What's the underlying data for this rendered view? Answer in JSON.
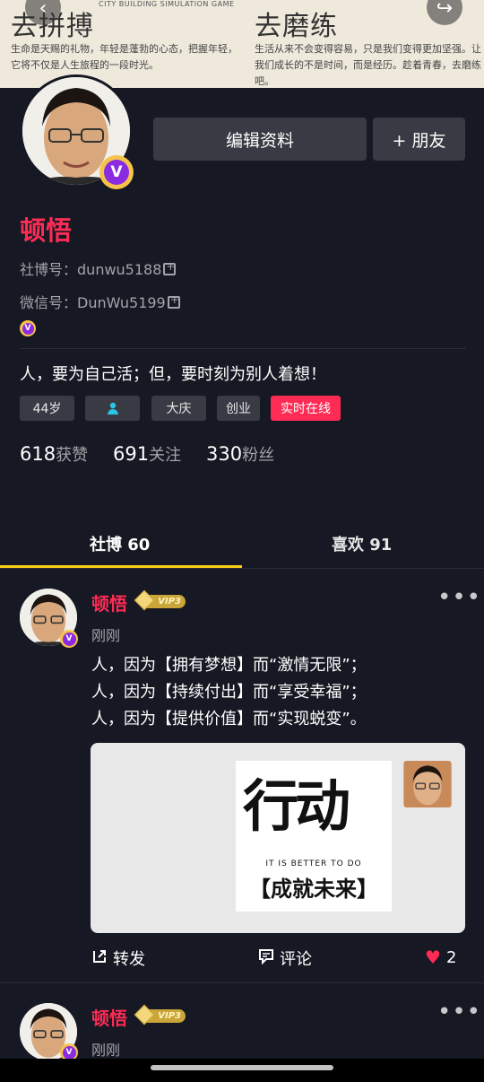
{
  "banner": {
    "left_title": "去拼搏",
    "left_tag": "CITY BUILDING SIMULATION GAME",
    "left_text": "生命是天赐的礼物，年轻是蓬勃的心态，把握年轻，它将不仅是人生旅程的一段时光。",
    "right_title": "去磨练",
    "right_text": "生活从来不会变得容易，只是我们变得更加坚强。让我们成长的不是时间，而是经历。趁着青春，去磨练吧。",
    "back_icon": "back-icon",
    "share_icon": "share-icon"
  },
  "profile": {
    "edit_button": "编辑资料",
    "add_friend_button": "+ 朋友",
    "name": "顿悟",
    "id_label": "社博号：",
    "id_value": "dunwu5188",
    "wechat_label": "微信号：",
    "wechat_value": "DunWu5199",
    "verified_badge": "V",
    "bio": "人，要为自己活；但，要时刻为别人着想！",
    "tags": [
      "44岁",
      "",
      "大庆",
      "创业",
      "实时在线"
    ],
    "stats": [
      {
        "value": "618",
        "label": "获赞"
      },
      {
        "value": "691",
        "label": "关注"
      },
      {
        "value": "330",
        "label": "粉丝"
      }
    ]
  },
  "tabs": {
    "posts": "社博 60",
    "likes": "喜欢 91"
  },
  "posts": [
    {
      "author": "顿悟",
      "vip": "VIP3",
      "time": "刚刚",
      "lines": [
        "人，因为【拥有梦想】而“激情无限”；",
        "人，因为【持续付出】而“享受幸福”；",
        "人，因为【提供价值】而“实现蜕变”。"
      ],
      "poster_big": "行动",
      "poster_sub": "IT IS BETTER TO DO",
      "poster_banner": "【成就未来】",
      "share_label": "转发",
      "comment_label": "评论",
      "like_count": "2"
    },
    {
      "author": "顿悟",
      "vip": "VIP3",
      "time": "刚刚"
    }
  ],
  "colors": {
    "background": "#161823",
    "accent": "#fe2c55",
    "tab_indicator": "#face15",
    "button": "#393b44"
  }
}
